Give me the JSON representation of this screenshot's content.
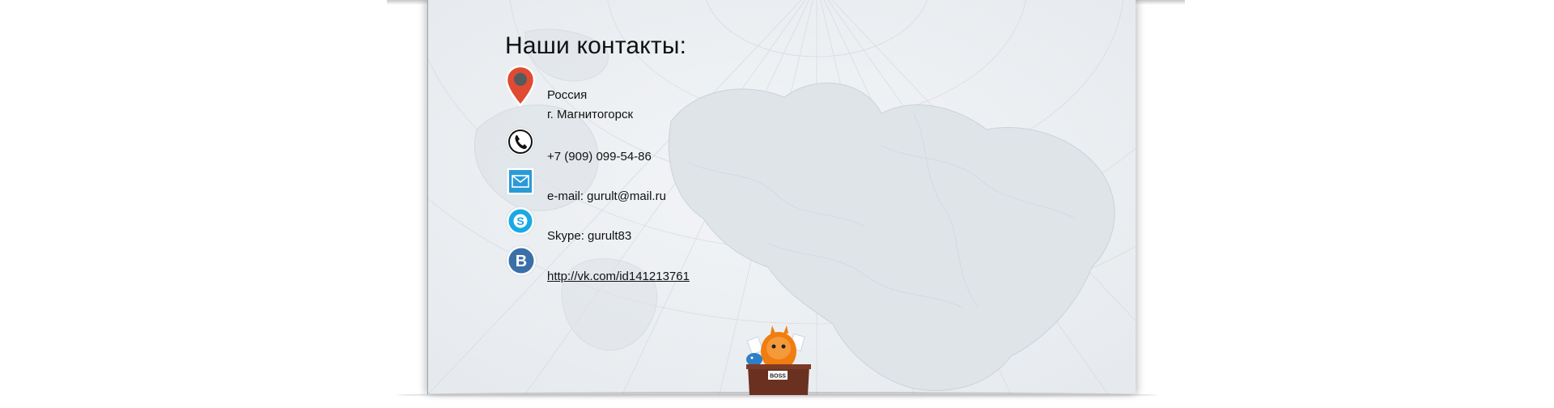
{
  "contacts": {
    "title": "Наши контакты:",
    "address": {
      "icon": "map-pin-icon",
      "line1": "Россия",
      "line2": "г. Магнитогорск"
    },
    "phone": {
      "icon": "phone-icon",
      "text": "+7 (909) 099-54-86"
    },
    "email": {
      "icon": "mail-icon",
      "text": "e-mail: gurult@mail.ru"
    },
    "skype": {
      "icon": "skype-icon",
      "text": "Skype: gurult83"
    },
    "vk": {
      "icon": "vk-icon",
      "text": "http://vk.com/id141213761"
    }
  },
  "mascot": {
    "badge_text": "BOSS"
  },
  "colors": {
    "pin_red": "#e04a32",
    "mail_blue": "#2a9ad6",
    "skype_blue": "#19a9e5",
    "vk_blue": "#3a6fa8",
    "mascot_orange": "#f07d10"
  }
}
